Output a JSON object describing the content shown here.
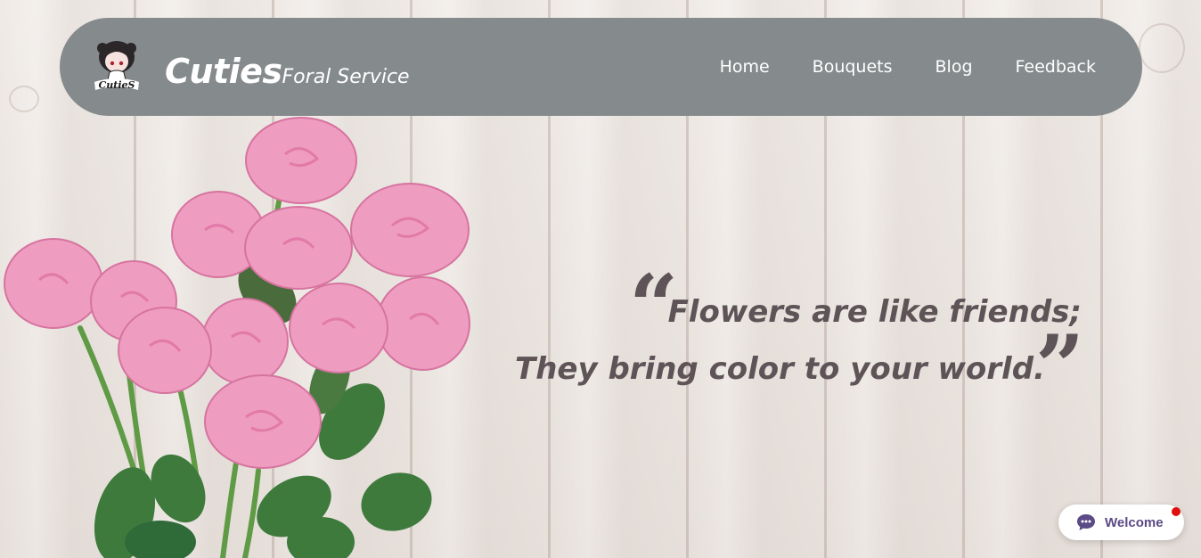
{
  "brand": {
    "name": "Cuties",
    "tagline": "Foral Service",
    "logo_text": "CutieS"
  },
  "nav": {
    "items": [
      {
        "label": "Home"
      },
      {
        "label": "Bouquets"
      },
      {
        "label": "Blog"
      },
      {
        "label": "Feedback"
      }
    ]
  },
  "hero": {
    "quote_line1": "Flowers are like friends;",
    "quote_line2": "They bring color to your world.",
    "open_quote": "“",
    "close_quote": "”"
  },
  "chat_widget": {
    "label": "Welcome",
    "icon": "chat-bubble-icon",
    "notification_color": "#e01010",
    "accent_color": "#5b4a86"
  },
  "colors": {
    "navbar_bg": "#858a8c",
    "quote_text": "#5e5458",
    "rose_pink": "#f29bc0",
    "leaf_green": "#2f6b38"
  }
}
